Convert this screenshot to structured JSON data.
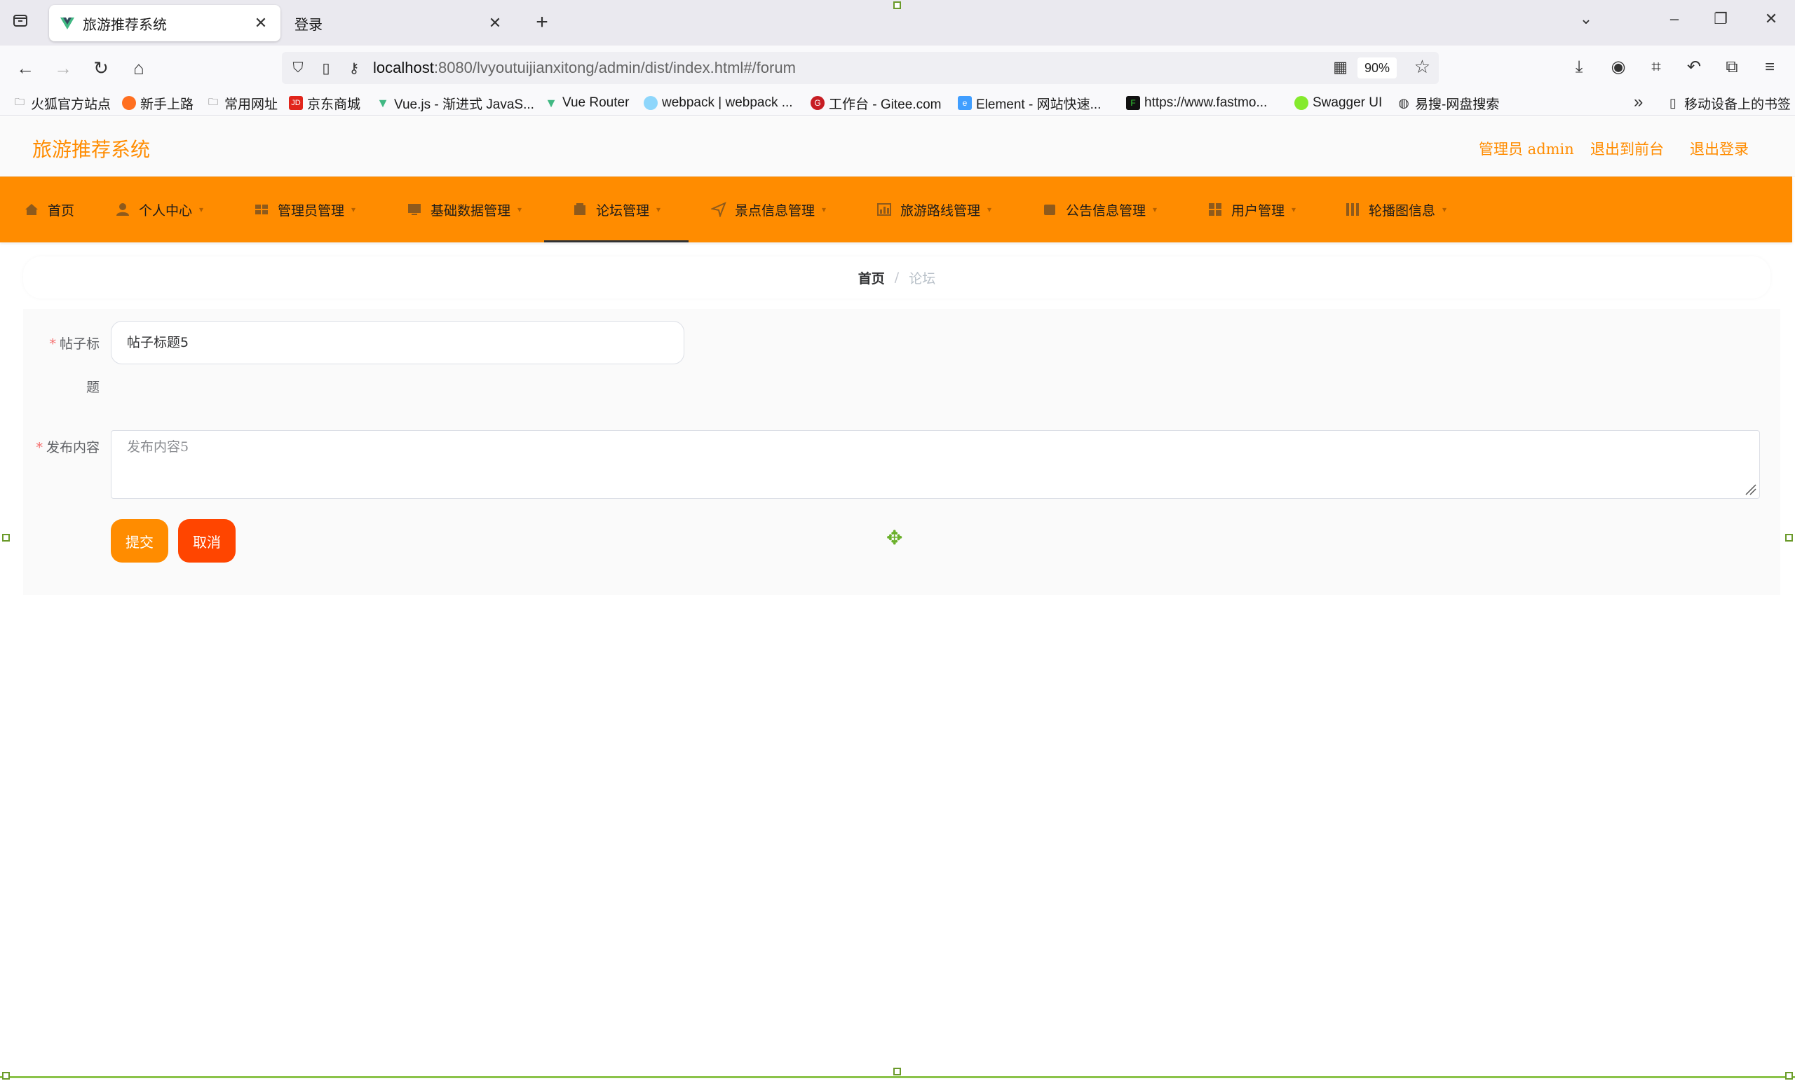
{
  "browser": {
    "tabs": [
      {
        "title": "旅游推荐系统",
        "active": true
      },
      {
        "title": "登录",
        "active": false
      }
    ],
    "url_host": "localhost",
    "url_rest": ":8080/lvyoutuijianxitong/admin/dist/index.html#/forum",
    "zoom": "90%",
    "bookmarks": [
      {
        "label": "火狐官方站点",
        "icon": "folder-icon"
      },
      {
        "label": "新手上路",
        "icon": "firefox-icon"
      },
      {
        "label": "常用网址",
        "icon": "folder-icon"
      },
      {
        "label": "京东商城",
        "icon": "jd-icon"
      },
      {
        "label": "Vue.js - 渐进式 JavaS...",
        "icon": "vue-icon"
      },
      {
        "label": "Vue Router",
        "icon": "vue-icon"
      },
      {
        "label": "webpack | webpack ...",
        "icon": "webpack-icon"
      },
      {
        "label": "工作台 - Gitee.com",
        "icon": "gitee-icon"
      },
      {
        "label": "Element - 网站快速...",
        "icon": "element-icon"
      },
      {
        "label": "https://www.fastmo...",
        "icon": "fastmock-icon"
      },
      {
        "label": "Swagger UI",
        "icon": "swagger-icon"
      },
      {
        "label": "易搜-网盘搜索",
        "icon": "globe-icon"
      }
    ],
    "mobile_bookmarks": "移动设备上的书签"
  },
  "app": {
    "title": "旅游推荐系统",
    "header_links": {
      "user": "管理员 admin",
      "to_front": "退出到前台",
      "logout": "退出登录"
    },
    "menu": [
      {
        "label": "首页",
        "icon": "home-icon"
      },
      {
        "label": "个人中心",
        "icon": "user-icon"
      },
      {
        "label": "管理员管理",
        "icon": "admin-icon"
      },
      {
        "label": "基础数据管理",
        "icon": "monitor-icon"
      },
      {
        "label": "论坛管理",
        "icon": "forum-icon",
        "active": true
      },
      {
        "label": "景点信息管理",
        "icon": "send-icon"
      },
      {
        "label": "旅游路线管理",
        "icon": "chart-icon"
      },
      {
        "label": "公告信息管理",
        "icon": "notice-icon"
      },
      {
        "label": "用户管理",
        "icon": "grid-icon"
      },
      {
        "label": "轮播图信息",
        "icon": "columns-icon"
      }
    ],
    "breadcrumb": {
      "home": "首页",
      "separator": "/",
      "current": "论坛"
    },
    "form": {
      "title_label_line1": "帖子标",
      "title_label_line2": "题",
      "title_value": "帖子标题5",
      "content_label": "发布内容",
      "content_value": "发布内容5",
      "required_mark": "*",
      "submit": "提交",
      "cancel": "取消"
    }
  },
  "colors": {
    "accent": "#ff8c00",
    "danger": "#ff4500",
    "required": "#f56c6c"
  }
}
